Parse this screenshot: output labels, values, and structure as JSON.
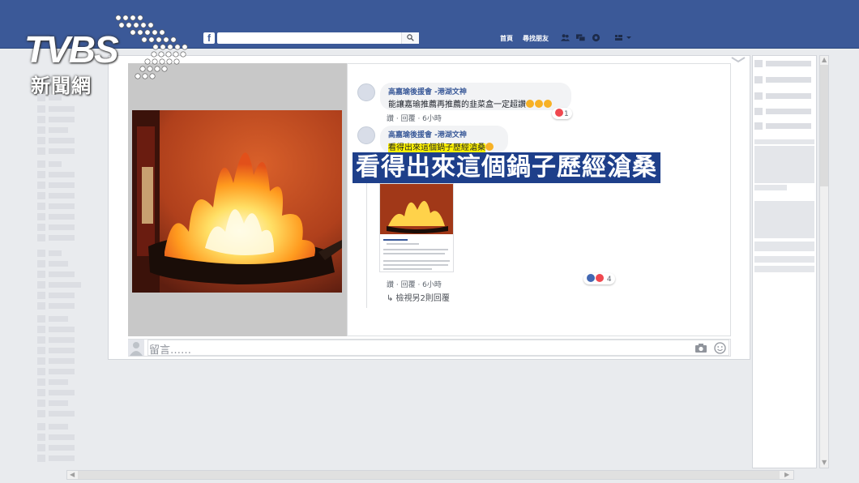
{
  "topbar": {
    "fb_logo": "f",
    "nav_home": "首頁",
    "nav_find_friends": "尋找朋友",
    "icons": [
      "friend-requests-icon",
      "messages-icon",
      "notifications-icon",
      "settings-icon"
    ]
  },
  "watermark": {
    "brand": "TVBS",
    "sub": "新聞網"
  },
  "comments": [
    {
      "name": "高嘉瑜後援會 -港湖文神",
      "text": "能讓嘉瑜推薦再推薦的韭菜盒一定超讚",
      "reaction_count": "1",
      "meta": "讚 · 回覆 · 6小時"
    },
    {
      "name": "高嘉瑜後援會 -港湖文神",
      "text": "看得出來這個鍋子歷經滄桑",
      "reaction_count": "4",
      "meta": "讚 · 回覆 · 6小時"
    }
  ],
  "more_replies": "↳ 檢視另2則回覆",
  "caption": "看得出來這個鍋子歷經滄桑",
  "comment_input": {
    "placeholder": "留言……"
  },
  "colors": {
    "facebook_blue": "#3b5998",
    "caption_bg": "#1e3f8a",
    "highlight": "#fff200"
  }
}
